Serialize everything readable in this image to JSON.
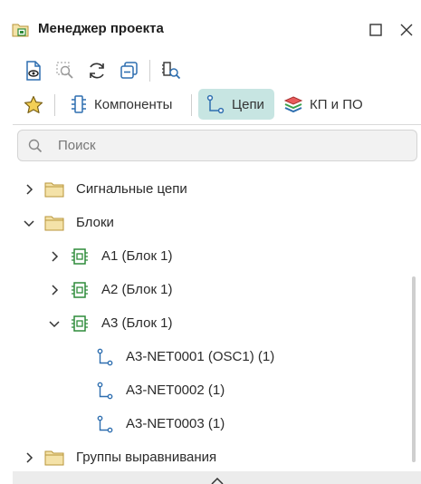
{
  "window": {
    "title": "Менеджер проекта",
    "title_icon": "project-folder-icon",
    "maximize_icon": "maximize-icon",
    "close_icon": "close-icon"
  },
  "toolbar": {
    "buttons": [
      {
        "icon": "document-view-icon"
      },
      {
        "icon": "zoom-to-selection-icon"
      },
      {
        "icon": "refresh-icon"
      },
      {
        "icon": "collapse-all-icon"
      },
      {
        "icon": "find-component-icon"
      }
    ]
  },
  "tabs": {
    "favorites_icon": "star-icon",
    "items": [
      {
        "label": "Компоненты",
        "icon": "component-icon",
        "active": false
      },
      {
        "label": "Цепи",
        "icon": "net-icon",
        "active": true
      },
      {
        "label": "КП и ПО",
        "icon": "layers-icon",
        "active": false
      }
    ]
  },
  "search": {
    "placeholder": "Поиск",
    "icon": "search-icon"
  },
  "tree": {
    "items": [
      {
        "label": "Сигнальные цепи",
        "type": "folder",
        "expanded": false,
        "level": 0
      },
      {
        "label": "Блоки",
        "type": "folder",
        "expanded": true,
        "level": 0
      },
      {
        "label": "A1 (Блок 1)",
        "type": "block",
        "expanded": false,
        "level": 1
      },
      {
        "label": "A2 (Блок 1)",
        "type": "block",
        "expanded": false,
        "level": 1
      },
      {
        "label": "A3 (Блок 1)",
        "type": "block",
        "expanded": true,
        "level": 1
      },
      {
        "label": "A3-NET0001 (OSC1) (1)",
        "type": "net",
        "level": 2
      },
      {
        "label": "A3-NET0002 (1)",
        "type": "net",
        "level": 2
      },
      {
        "label": "A3-NET0003 (1)",
        "type": "net",
        "level": 2
      },
      {
        "label": "Группы выравнивания",
        "type": "folder",
        "expanded": false,
        "level": 0
      }
    ]
  },
  "colors": {
    "active_tab": "#c7e5e2",
    "block_icon": "#2e8b3a",
    "net_icon": "#2f6fb0",
    "folder": "#e7c56a"
  }
}
